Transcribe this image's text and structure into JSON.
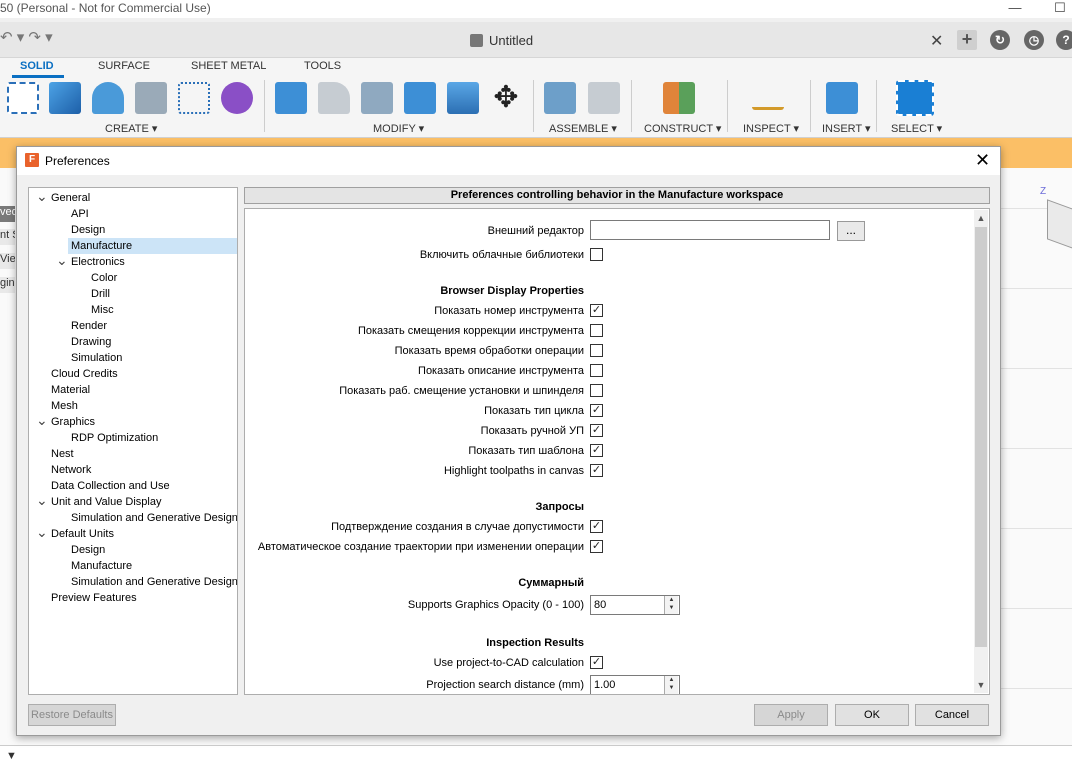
{
  "app": {
    "title": "50 (Personal - Not for Commercial Use)"
  },
  "window_controls": {
    "minimize": "—",
    "maximize": "☐"
  },
  "doc_tab": {
    "title": "Untitled",
    "close": "✕"
  },
  "ribbon": {
    "tabs": [
      "SOLID",
      "SURFACE",
      "SHEET METAL",
      "TOOLS"
    ],
    "groups": [
      "CREATE ▾",
      "MODIFY ▾",
      "ASSEMBLE ▾",
      "CONSTRUCT ▾",
      "INSPECT ▾",
      "INSERT ▾",
      "SELECT ▾"
    ]
  },
  "side_fragments": [
    "ved",
    "nt S",
    "Viev",
    "gin"
  ],
  "dialog": {
    "title": "Preferences",
    "close": "✕",
    "tree": [
      {
        "label": "General",
        "level": 0,
        "expander": "open"
      },
      {
        "label": "API",
        "level": 1
      },
      {
        "label": "Design",
        "level": 1
      },
      {
        "label": "Manufacture",
        "level": 1,
        "selected": true
      },
      {
        "label": "Electronics",
        "level": 1,
        "expander": "open"
      },
      {
        "label": "Color",
        "level": 2
      },
      {
        "label": "Drill",
        "level": 2
      },
      {
        "label": "Misc",
        "level": 2
      },
      {
        "label": "Render",
        "level": 1
      },
      {
        "label": "Drawing",
        "level": 1
      },
      {
        "label": "Simulation",
        "level": 1
      },
      {
        "label": "Cloud Credits",
        "level": 0
      },
      {
        "label": "Material",
        "level": 0
      },
      {
        "label": "Mesh",
        "level": 0
      },
      {
        "label": "Graphics",
        "level": 0,
        "expander": "open"
      },
      {
        "label": "RDP Optimization",
        "level": 1
      },
      {
        "label": "Nest",
        "level": 0
      },
      {
        "label": "Network",
        "level": 0
      },
      {
        "label": "Data Collection and Use",
        "level": 0
      },
      {
        "label": "Unit and Value Display",
        "level": 0,
        "expander": "open"
      },
      {
        "label": "Simulation and Generative Design",
        "level": 1
      },
      {
        "label": "Default Units",
        "level": 0,
        "expander": "open"
      },
      {
        "label": "Design",
        "level": 1
      },
      {
        "label": "Manufacture",
        "level": 1
      },
      {
        "label": "Simulation and Generative Design",
        "level": 1
      },
      {
        "label": "Preview Features",
        "level": 0
      }
    ],
    "content_header": "Preferences controlling behavior in the Manufacture workspace",
    "external_editor": {
      "label": "Внешний редактор",
      "value": "",
      "browse": "..."
    },
    "cloud_libraries": {
      "label": "Включить облачные библиотеки",
      "checked": false
    },
    "browser_display": {
      "title": "Browser Display Properties",
      "items": [
        {
          "label": "Показать номер инструмента",
          "checked": true
        },
        {
          "label": "Показать смещения коррекции инструмента",
          "checked": false
        },
        {
          "label": "Показать время обработки операции",
          "checked": false
        },
        {
          "label": "Показать описание инструмента",
          "checked": false
        },
        {
          "label": "Показать раб. смещение установки и шпинделя",
          "checked": false
        },
        {
          "label": "Показать тип цикла",
          "checked": true
        },
        {
          "label": "Показать ручной УП",
          "checked": true
        },
        {
          "label": "Показать тип шаблона",
          "checked": true
        },
        {
          "label": "Highlight toolpaths in canvas",
          "checked": true
        }
      ]
    },
    "requests": {
      "title": "Запросы",
      "items": [
        {
          "label": "Подтверждение создания в случае допустимости",
          "checked": true
        },
        {
          "label": "Автоматическое создание траектории при изменении операции",
          "checked": true
        }
      ]
    },
    "summary": {
      "title": "Суммарный",
      "opacity_label": "Supports Graphics Opacity (0 - 100)",
      "opacity_value": "80"
    },
    "inspection": {
      "title": "Inspection Results",
      "project_label": "Use project-to-CAD calculation",
      "project_checked": true,
      "distance_label": "Projection search distance (mm)",
      "distance_value": "1.00"
    },
    "buttons": {
      "restore": "Restore Defaults",
      "apply": "Apply",
      "ok": "OK",
      "cancel": "Cancel"
    }
  }
}
